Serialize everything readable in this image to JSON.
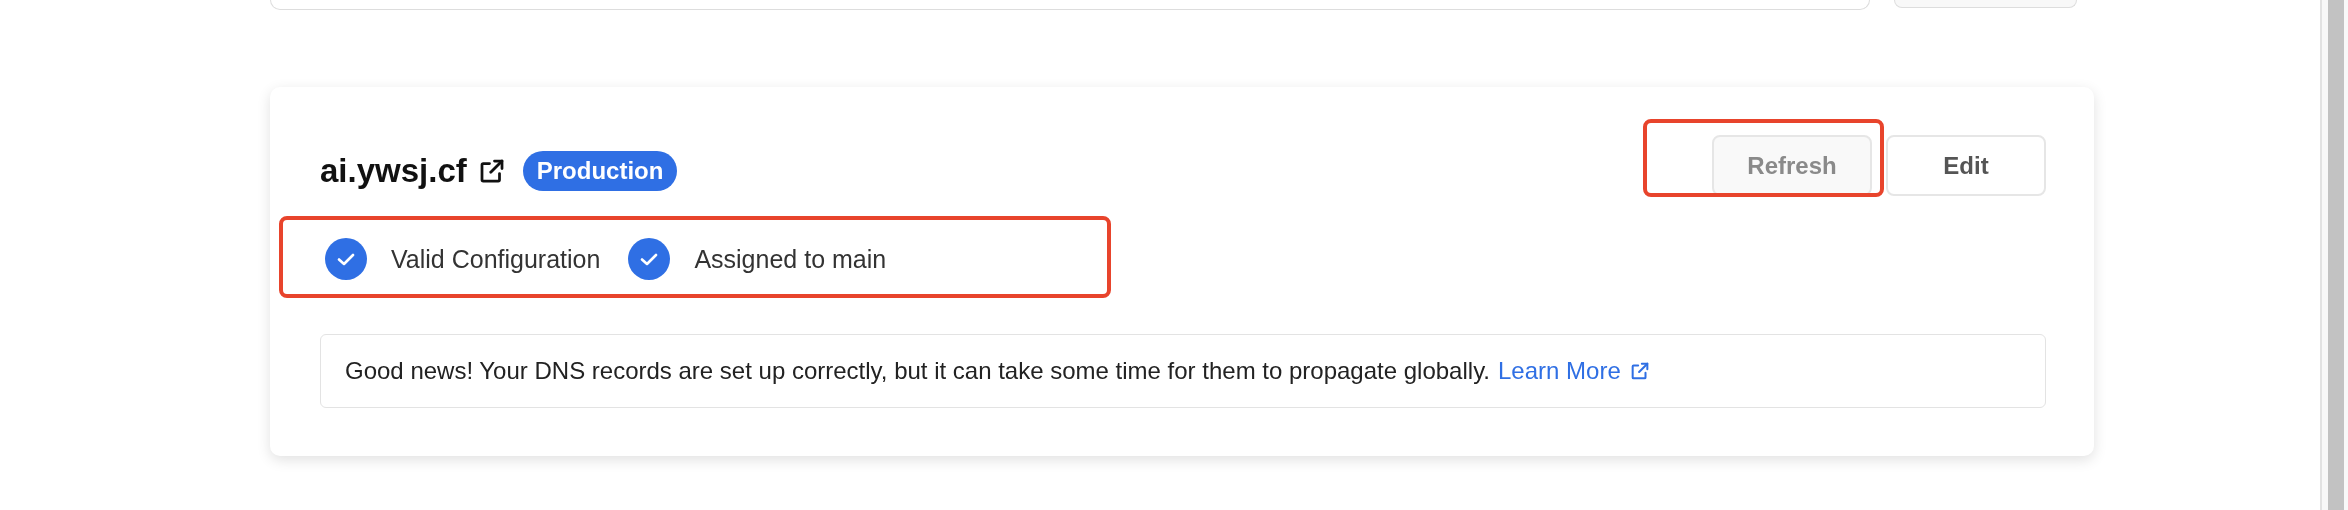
{
  "domain_card": {
    "domain": "ai.ywsj.cf",
    "environment_badge": "Production",
    "actions": [
      {
        "label": "Refresh",
        "disabled": true,
        "highlighted": true
      },
      {
        "label": "Edit",
        "disabled": false,
        "highlighted": false
      }
    ],
    "status_highlighted": true,
    "statuses": [
      {
        "label": "Valid Configuration",
        "checked": true
      },
      {
        "label": "Assigned to main",
        "checked": true
      }
    ],
    "notice": {
      "text": "Good news! Your DNS records are set up correctly, but it can take some time for them to propagate globally.",
      "link": "Learn More"
    }
  }
}
